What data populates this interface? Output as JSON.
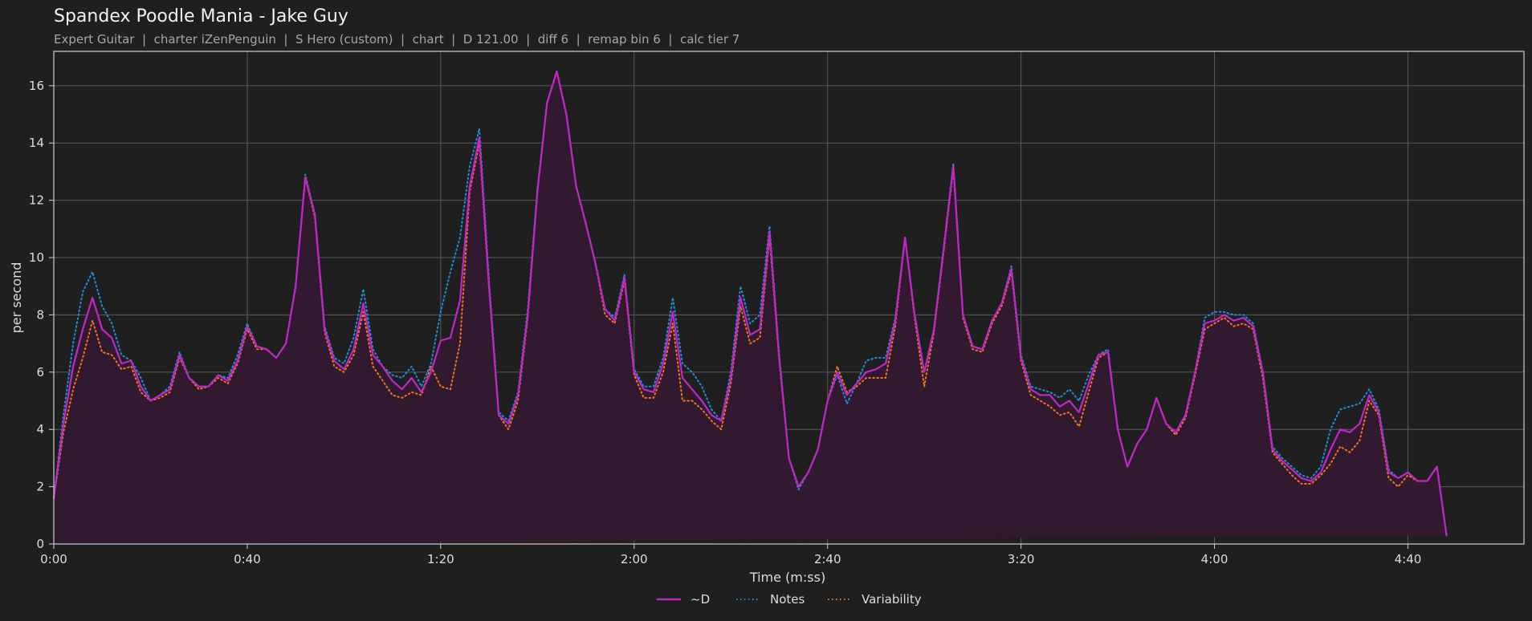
{
  "chart_data": {
    "type": "line",
    "title": "Spandex Poodle Mania - Jake Guy",
    "subtitle": "Expert Guitar  |  charter iZenPenguin  |  S Hero (custom)  |  chart  |  D 121.00  |  diff 6  |  remap bin 6  |  calc tier 7",
    "xlabel": "Time (m:ss)",
    "ylabel": "per second",
    "xlim": [
      0,
      304
    ],
    "ylim": [
      0,
      17.2
    ],
    "x_ticks": [
      {
        "value": 0,
        "label": "0:00"
      },
      {
        "value": 40,
        "label": "0:40"
      },
      {
        "value": 80,
        "label": "1:20"
      },
      {
        "value": 120,
        "label": "2:00"
      },
      {
        "value": 160,
        "label": "2:40"
      },
      {
        "value": 200,
        "label": "3:20"
      },
      {
        "value": 240,
        "label": "4:00"
      },
      {
        "value": 280,
        "label": "4:40"
      }
    ],
    "y_ticks": [
      {
        "value": 0,
        "label": "0"
      },
      {
        "value": 2,
        "label": "2"
      },
      {
        "value": 4,
        "label": "4"
      },
      {
        "value": 6,
        "label": "6"
      },
      {
        "value": 8,
        "label": "8"
      },
      {
        "value": 10,
        "label": "10"
      },
      {
        "value": 12,
        "label": "12"
      },
      {
        "value": 14,
        "label": "14"
      },
      {
        "value": 16,
        "label": "16"
      }
    ],
    "grid": true,
    "legend_position": "bottom-center",
    "x": [
      0,
      2,
      4,
      6,
      8,
      10,
      12,
      14,
      16,
      18,
      20,
      22,
      24,
      26,
      28,
      30,
      32,
      34,
      36,
      38,
      40,
      42,
      44,
      46,
      48,
      50,
      52,
      54,
      56,
      58,
      60,
      62,
      64,
      66,
      68,
      70,
      72,
      74,
      76,
      78,
      80,
      82,
      84,
      86,
      88,
      90,
      92,
      94,
      96,
      98,
      100,
      102,
      104,
      106,
      108,
      110,
      112,
      114,
      116,
      118,
      120,
      122,
      124,
      126,
      128,
      130,
      132,
      134,
      136,
      138,
      140,
      142,
      144,
      146,
      148,
      150,
      152,
      154,
      156,
      158,
      160,
      162,
      164,
      166,
      168,
      170,
      172,
      174,
      176,
      178,
      180,
      182,
      184,
      186,
      188,
      190,
      192,
      194,
      196,
      198,
      200,
      202,
      204,
      206,
      208,
      210,
      212,
      214,
      216,
      218,
      220,
      222,
      224,
      226,
      228,
      230,
      232,
      234,
      236,
      238,
      240,
      242,
      244,
      246,
      248,
      250,
      252,
      254,
      256,
      258,
      260,
      262,
      264,
      266,
      268,
      270,
      272,
      274,
      276,
      278,
      280,
      282,
      284,
      286,
      288,
      290,
      292,
      294,
      296,
      298,
      300,
      302,
      304
    ],
    "series": [
      {
        "name": "~D",
        "color": "#c026c8",
        "style": "solid",
        "values": [
          1.6,
          4.2,
          6.2,
          7.5,
          8.6,
          7.5,
          7.2,
          6.3,
          6.4,
          5.5,
          5.0,
          5.2,
          5.4,
          6.6,
          5.8,
          5.5,
          5.5,
          5.9,
          5.7,
          6.4,
          7.6,
          6.9,
          6.8,
          6.5,
          7.0,
          9.0,
          12.8,
          11.5,
          7.5,
          6.4,
          6.1,
          6.8,
          8.4,
          6.6,
          6.2,
          5.7,
          5.4,
          5.8,
          5.3,
          6.0,
          7.1,
          7.2,
          8.5,
          12.5,
          14.2,
          9.0,
          4.5,
          4.2,
          5.2,
          8.0,
          12.3,
          15.4,
          16.5,
          15.0,
          12.5,
          11.2,
          9.8,
          8.2,
          7.8,
          9.3,
          6.0,
          5.4,
          5.3,
          6.3,
          8.1,
          5.8,
          5.4,
          5.0,
          4.5,
          4.3,
          5.8,
          8.6,
          7.3,
          7.5,
          10.9,
          6.5,
          3.0,
          2.0,
          2.5,
          3.3,
          5.0,
          6.0,
          5.2,
          5.6,
          6.0,
          6.1,
          6.3,
          7.8,
          10.7,
          8.0,
          6.0,
          7.5,
          10.3,
          13.2,
          8.0,
          6.9,
          6.8,
          7.8,
          8.4,
          9.6,
          6.5,
          5.4,
          5.2,
          5.2,
          4.8,
          5.0,
          4.6,
          5.6,
          6.6,
          6.7,
          4.0,
          2.7,
          3.5,
          4.0,
          5.1,
          4.2,
          3.9,
          4.5,
          6.0,
          7.7,
          7.8,
          8.0,
          7.8,
          7.9,
          7.6,
          6.0,
          3.3,
          2.9,
          2.6,
          2.3,
          2.2,
          2.5,
          3.3,
          4.0,
          3.9,
          4.2,
          5.2,
          4.6,
          2.5,
          2.3,
          2.5,
          2.2,
          2.2,
          2.7,
          0.3
        ]
      },
      {
        "name": "Notes",
        "color": "#1f8fd6",
        "style": "dotted",
        "values": [
          1.6,
          4.5,
          7.0,
          8.8,
          9.5,
          8.3,
          7.7,
          6.6,
          6.4,
          5.8,
          5.0,
          5.2,
          5.5,
          6.7,
          5.8,
          5.5,
          5.5,
          5.9,
          5.8,
          6.6,
          7.7,
          6.9,
          6.8,
          6.5,
          7.0,
          9.0,
          12.9,
          11.5,
          7.6,
          6.5,
          6.3,
          7.2,
          8.9,
          6.8,
          6.2,
          5.9,
          5.8,
          6.2,
          5.5,
          6.3,
          8.1,
          9.5,
          10.7,
          13.2,
          14.5,
          9.2,
          4.6,
          4.3,
          5.3,
          8.2,
          12.4,
          15.4,
          16.5,
          15.0,
          12.5,
          11.2,
          9.8,
          8.2,
          7.9,
          9.4,
          6.1,
          5.5,
          5.5,
          6.5,
          8.6,
          6.3,
          6.0,
          5.5,
          4.7,
          4.3,
          6.0,
          9.0,
          7.7,
          8.0,
          11.1,
          6.6,
          3.0,
          1.9,
          2.5,
          3.3,
          5.0,
          5.9,
          4.9,
          5.6,
          6.4,
          6.5,
          6.5,
          7.9,
          10.7,
          8.0,
          6.0,
          7.5,
          10.3,
          13.3,
          8.0,
          6.9,
          6.8,
          7.8,
          8.4,
          9.7,
          6.6,
          5.5,
          5.4,
          5.3,
          5.1,
          5.4,
          5.0,
          5.9,
          6.6,
          6.8,
          4.0,
          2.7,
          3.5,
          4.0,
          5.1,
          4.2,
          3.9,
          4.5,
          6.0,
          7.9,
          8.1,
          8.1,
          8.0,
          8.0,
          7.7,
          6.0,
          3.4,
          3.0,
          2.7,
          2.4,
          2.3,
          2.7,
          4.0,
          4.7,
          4.8,
          4.9,
          5.4,
          4.7,
          2.6,
          2.3,
          2.5,
          2.2,
          2.2,
          2.7,
          0.3
        ]
      },
      {
        "name": "Variability",
        "color": "#f0771a",
        "style": "dotted",
        "values": [
          1.6,
          3.9,
          5.4,
          6.5,
          7.8,
          6.7,
          6.6,
          6.1,
          6.2,
          5.3,
          5.0,
          5.1,
          5.3,
          6.5,
          5.8,
          5.4,
          5.5,
          5.8,
          5.6,
          6.3,
          7.5,
          6.8,
          6.8,
          6.5,
          7.0,
          9.0,
          12.8,
          11.4,
          7.4,
          6.2,
          6.0,
          6.6,
          8.1,
          6.2,
          5.7,
          5.2,
          5.1,
          5.3,
          5.2,
          6.2,
          5.5,
          5.4,
          7.0,
          12.3,
          14.0,
          8.9,
          4.5,
          4.0,
          5.0,
          7.9,
          12.3,
          15.4,
          16.5,
          15.0,
          12.5,
          11.2,
          9.8,
          8.0,
          7.7,
          9.2,
          5.9,
          5.1,
          5.1,
          6.0,
          7.7,
          5.0,
          5.0,
          4.7,
          4.3,
          4.0,
          5.6,
          8.3,
          7.0,
          7.2,
          10.7,
          6.4,
          3.0,
          2.0,
          2.5,
          3.3,
          5.0,
          6.2,
          5.3,
          5.5,
          5.8,
          5.8,
          5.8,
          7.6,
          10.7,
          7.9,
          5.5,
          7.4,
          10.2,
          13.1,
          7.9,
          6.8,
          6.7,
          7.7,
          8.3,
          9.5,
          6.4,
          5.2,
          5.0,
          4.8,
          4.5,
          4.6,
          4.1,
          5.3,
          6.5,
          6.7,
          4.0,
          2.7,
          3.5,
          4.0,
          5.1,
          4.2,
          3.8,
          4.4,
          5.9,
          7.5,
          7.7,
          7.9,
          7.6,
          7.7,
          7.5,
          5.8,
          3.2,
          2.8,
          2.4,
          2.1,
          2.1,
          2.4,
          2.8,
          3.4,
          3.2,
          3.6,
          5.0,
          4.5,
          2.3,
          2.0,
          2.4,
          2.2,
          2.2,
          2.7,
          0.3
        ]
      }
    ],
    "fill_color": "#311a2f",
    "background_color": "#1f1f1f"
  }
}
